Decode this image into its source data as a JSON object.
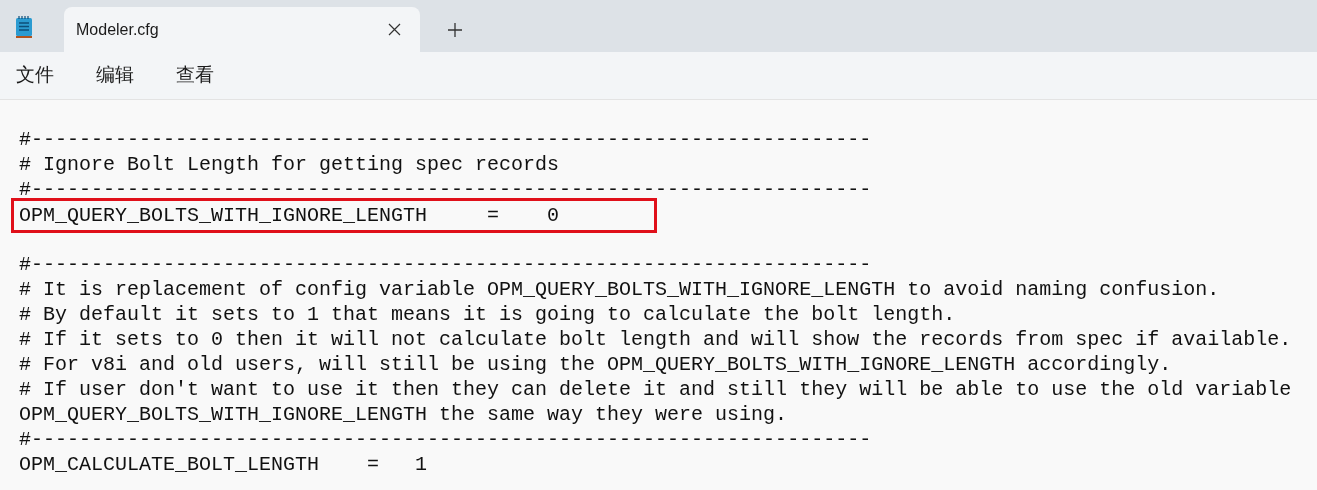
{
  "tabs": [
    {
      "label": "Modeler.cfg",
      "selected": true
    }
  ],
  "menu": [
    "文件",
    "编辑",
    "查看"
  ],
  "editor": {
    "blocks": [
      {
        "lines": [
          {
            "text": "#----------------------------------------------------------------------",
            "highlighted": false
          },
          {
            "text": "# Ignore Bolt Length for getting spec records",
            "highlighted": false
          },
          {
            "text": "#----------------------------------------------------------------------",
            "highlighted": false
          },
          {
            "text": "OPM_QUERY_BOLTS_WITH_IGNORE_LENGTH     =    0",
            "highlighted": true
          }
        ]
      },
      {
        "lines": [
          {
            "text": "#----------------------------------------------------------------------",
            "highlighted": false
          },
          {
            "text": "# It is replacement of config variable OPM_QUERY_BOLTS_WITH_IGNORE_LENGTH to avoid naming confusion.",
            "highlighted": false
          },
          {
            "text": "# By default it sets to 1 that means it is going to calculate the bolt length.",
            "highlighted": false
          },
          {
            "text": "# If it sets to 0 then it will not calculate bolt length and will show the records from spec if available.",
            "highlighted": false
          },
          {
            "text": "# For v8i and old users, will still be using the OPM_QUERY_BOLTS_WITH_IGNORE_LENGTH accordingly.",
            "highlighted": false
          },
          {
            "text": "# If user don't want to use it then they can delete it and still they will be able to use the old variable",
            "highlighted": false
          },
          {
            "text": "OPM_QUERY_BOLTS_WITH_IGNORE_LENGTH the same way they were using.",
            "highlighted": false
          },
          {
            "text": "#----------------------------------------------------------------------",
            "highlighted": false
          },
          {
            "text": "OPM_CALCULATE_BOLT_LENGTH    =   1",
            "highlighted": false
          }
        ]
      }
    ]
  }
}
